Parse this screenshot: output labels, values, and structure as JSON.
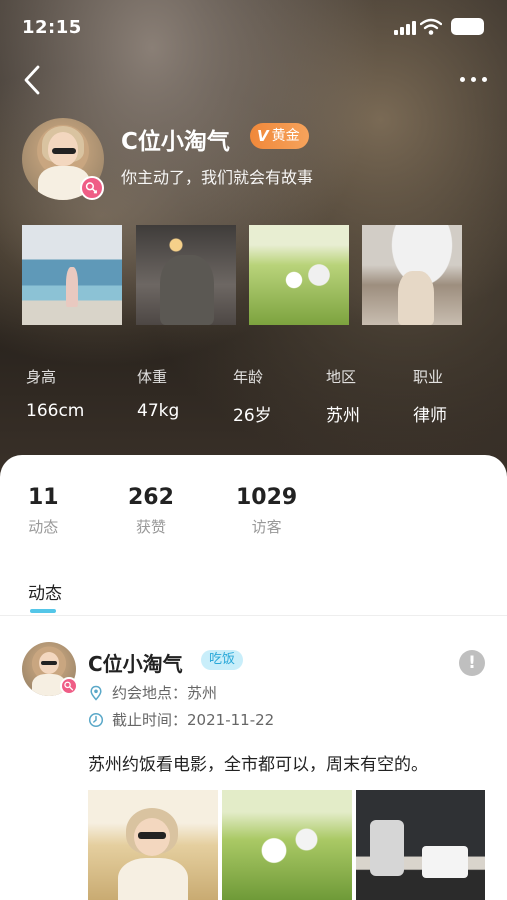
{
  "status_bar": {
    "time": "12:15"
  },
  "profile": {
    "name": "C位小淘气",
    "vip_label": "黄金",
    "vip_mark": "V",
    "signature": "你主动了，我们就会有故事"
  },
  "info": [
    {
      "label": "身高",
      "value": "166cm"
    },
    {
      "label": "体重",
      "value": "47kg"
    },
    {
      "label": "年龄",
      "value": "26岁"
    },
    {
      "label": "地区",
      "value": "苏州"
    },
    {
      "label": "职业",
      "value": "律师"
    }
  ],
  "stats": [
    {
      "num": "11",
      "label": "动态"
    },
    {
      "num": "262",
      "label": "获赞"
    },
    {
      "num": "1029",
      "label": "访客"
    }
  ],
  "tabs": {
    "active": "动态"
  },
  "post": {
    "name": "C位小淘气",
    "tag": "吃饭",
    "report_mark": "!",
    "location_label": "约会地点：",
    "location": "苏州",
    "deadline_label": "截止时间：",
    "deadline": "2021-11-22",
    "text": "苏州约饭看电影，全市都可以，周末有空的。"
  },
  "icons": {
    "back": "back-arrow-icon",
    "more": "more-dots-icon",
    "location": "location-pin-icon",
    "clock": "clock-icon",
    "female": "female-icon",
    "report": "exclamation-icon"
  },
  "colors": {
    "vip": "#f0883a",
    "accent": "#54c6e8",
    "female": "#ef5d86",
    "tag_bg": "#c9eefa",
    "tag_text": "#2aa8d8"
  }
}
